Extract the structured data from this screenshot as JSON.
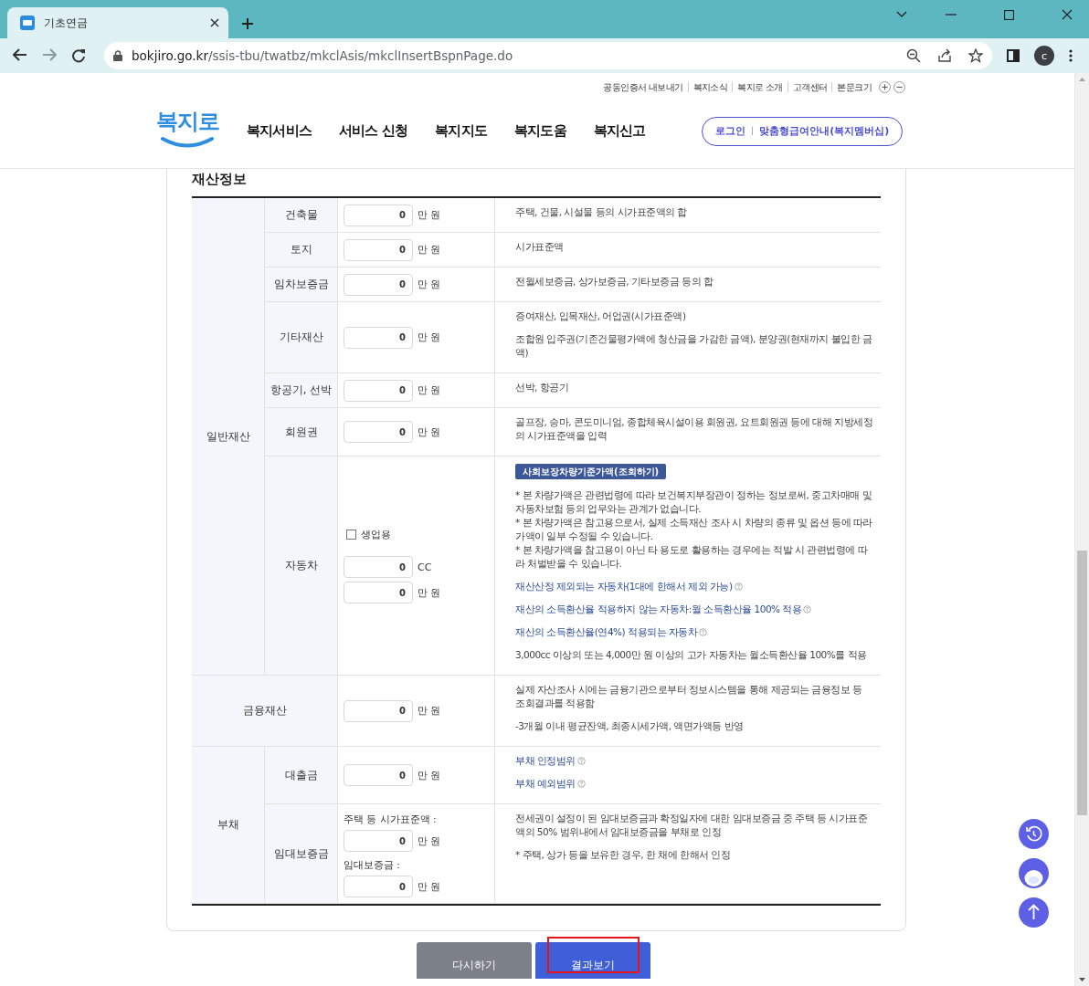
{
  "browser": {
    "tab_title": "기초연금",
    "url_host": "bokjiro.go.kr",
    "url_path": "/ssis-tbu/twatbz/mkclAsis/mkclInsertBspnPage.do",
    "profile_initial": "c"
  },
  "header": {
    "utility_links": [
      "공동인증서 내보내기",
      "복지소식",
      "복지로 소개",
      "고객센터",
      "본문크기"
    ],
    "logo": "복지로",
    "nav": [
      "복지서비스",
      "서비스 신청",
      "복지지도",
      "복지도움",
      "복지신고"
    ],
    "login": "로그인",
    "membership": "맞춤형급여안내(복지멤버십)"
  },
  "section_title": "재산정보",
  "groups": [
    {
      "label": "일반재산",
      "rows": [
        {
          "label": "건축물",
          "inputs": [
            {
              "value": "0",
              "unit": "만 원"
            }
          ],
          "description": [
            {
              "kind": "text",
              "text": "주택, 건물, 시설물 등의 시가표준액의 합"
            }
          ]
        },
        {
          "label": "토지",
          "inputs": [
            {
              "value": "0",
              "unit": "만 원"
            }
          ],
          "description": [
            {
              "kind": "text",
              "text": "시가표준액"
            }
          ]
        },
        {
          "label": "임차보증금",
          "inputs": [
            {
              "value": "0",
              "unit": "만 원"
            }
          ],
          "description": [
            {
              "kind": "text",
              "text": "전월세보증금, 상가보증금, 기타보증금 등의 합"
            }
          ]
        },
        {
          "label": "기타재산",
          "inputs": [
            {
              "value": "0",
              "unit": "만 원"
            }
          ],
          "description": [
            {
              "kind": "text",
              "text": "증여재산, 입목재산, 어업권(시가표준액)"
            },
            {
              "kind": "text",
              "text": "조합원 입주권(기존건물평가액에 청산금을 가감한 금액), 분양권(현재까지 불입한 금액)"
            }
          ]
        },
        {
          "label": "항공기, 선박",
          "inputs": [
            {
              "value": "0",
              "unit": "만 원"
            }
          ],
          "description": [
            {
              "kind": "text",
              "text": "선박, 항공기"
            }
          ]
        },
        {
          "label": "회원권",
          "inputs": [
            {
              "value": "0",
              "unit": "만 원"
            }
          ],
          "description": [
            {
              "kind": "text",
              "text": "골프장, 승마, 콘도미니엄, 종합체육시설이용 회원권, 요트회원권 등에 대해 지방세정의 시가표준액을 입력"
            }
          ]
        },
        {
          "label": "자동차",
          "checkbox": {
            "label": "생업용",
            "checked": false
          },
          "inputs": [
            {
              "value": "0",
              "unit": "CC"
            },
            {
              "value": "0",
              "unit": "만 원"
            }
          ],
          "description": [
            {
              "kind": "lookup_button",
              "text": "사회보장차량기준가액(조회하기)"
            },
            {
              "kind": "notes",
              "lines": [
                "* 본 차량가액은 관련법령에 따라 보건복지부장관이 정하는 정보로써, 중고차매매 및 자동차보험 등의 업무와는 관계가 없습니다.",
                "* 본 차량가액은 참고용으로서, 실제 소득재산 조사 시 차량의 종류 및 옵션 등에 따라 가액이 일부 수정될 수 있습니다.",
                "* 본 차량가액을 참고용이 아닌 타 용도로 활용하는 경우에는 적발 시 관련법령에 따라 처벌받을 수 있습니다."
              ]
            },
            {
              "kind": "link",
              "text": "재산산정 제외되는 자동차(1대에 한해서 제외 가능)"
            },
            {
              "kind": "link",
              "text": "재산의 소득환산율 적용하지 않는 자동차:월 소득환산율 100% 적용"
            },
            {
              "kind": "link",
              "text": "재산의 소득환산율(연4%) 적용되는 자동차"
            },
            {
              "kind": "text",
              "text": "3,000cc 이상의 또는 4,000만 원 이상의 고가 자동차는 월소득환산율 100%를 적용"
            }
          ]
        }
      ]
    },
    {
      "label": "금융재산",
      "rows": [
        {
          "inputs": [
            {
              "value": "0",
              "unit": "만 원"
            }
          ],
          "description": [
            {
              "kind": "text",
              "text": "실제 자산조사 시에는 금융기관으로부터 정보시스템을 통해 제공되는 금융정보 등 조회결과를 적용함"
            },
            {
              "kind": "text",
              "text": "-3개월 이내 평균잔액, 최종시세가액, 액면가액등 반영"
            }
          ]
        }
      ]
    },
    {
      "label": "부채",
      "rows": [
        {
          "label": "대출금",
          "inputs": [
            {
              "value": "0",
              "unit": "만 원"
            }
          ],
          "description": [
            {
              "kind": "link",
              "text": "부채 인정범위"
            },
            {
              "kind": "link",
              "text": "부채 예외범위"
            }
          ]
        },
        {
          "label": "임대보증금",
          "inputs": [
            {
              "caption": "주택 등 시가표준액 :",
              "value": "0",
              "unit": "만 원"
            },
            {
              "caption": "임대보증금 :",
              "value": "0",
              "unit": "만 원"
            }
          ],
          "description": [
            {
              "kind": "text",
              "text": "전세권이 설정이 된 임대보증금과 확정일자에 대한 임대보증금 중 주택 등 시가표준액의 50% 범위내에서 임대보증금을 부채로 인정"
            },
            {
              "kind": "text",
              "text": "* 주택, 상가 등을 보유한 경우, 한 채에 한해서 인정"
            }
          ]
        }
      ]
    }
  ],
  "actions": [
    {
      "label": "다시하기",
      "kind": "secondary",
      "highlighted": false
    },
    {
      "label": "결과보기",
      "kind": "primary",
      "highlighted": true
    }
  ]
}
